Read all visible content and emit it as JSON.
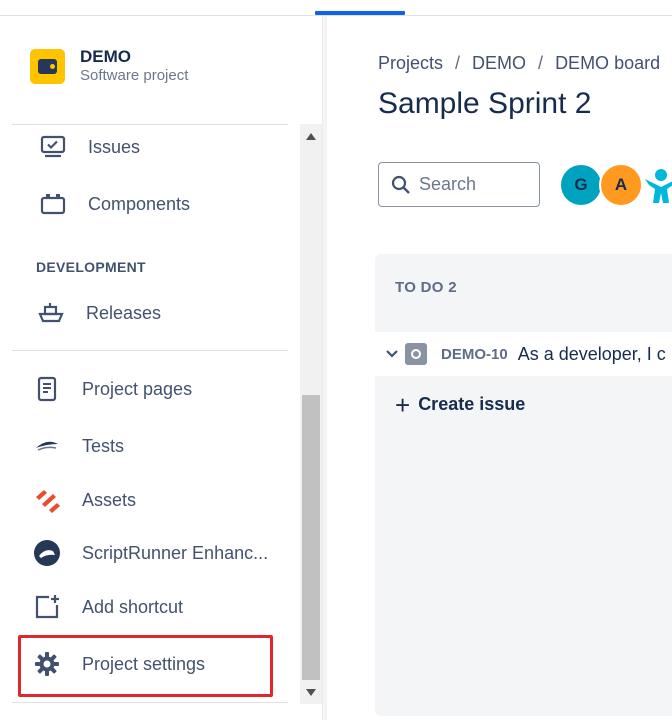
{
  "sidebar": {
    "project": {
      "name": "DEMO",
      "type": "Software project"
    },
    "items_top": [
      {
        "label": "Issues",
        "icon": "issues-icon"
      },
      {
        "label": "Components",
        "icon": "components-icon"
      }
    ],
    "section_heading": "DEVELOPMENT",
    "items_dev": [
      {
        "label": "Releases",
        "icon": "releases-icon"
      }
    ],
    "items_bottom": [
      {
        "label": "Project pages",
        "icon": "project-pages-icon"
      },
      {
        "label": "Tests",
        "icon": "tests-icon"
      },
      {
        "label": "Assets",
        "icon": "assets-icon"
      },
      {
        "label": "ScriptRunner Enhanc...",
        "icon": "scriptrunner-icon"
      },
      {
        "label": "Add shortcut",
        "icon": "add-shortcut-icon"
      },
      {
        "label": "Project settings",
        "icon": "gear-icon"
      }
    ]
  },
  "breadcrumb": [
    "Projects",
    "DEMO",
    "DEMO board"
  ],
  "page": {
    "title": "Sample Sprint 2"
  },
  "search": {
    "placeholder": "Search"
  },
  "avatars": [
    {
      "initial": "G",
      "color": "#00a3bf"
    },
    {
      "initial": "A",
      "color": "#ff991f"
    }
  ],
  "board": {
    "column_header": "TO DO 2",
    "issue": {
      "key": "DEMO-10",
      "summary": "As a developer, I c"
    },
    "create_issue_label": "Create issue"
  },
  "colors": {
    "accent": "#0c66e4",
    "highlight": "#e3262b",
    "project_avatar": "#ffc400"
  }
}
